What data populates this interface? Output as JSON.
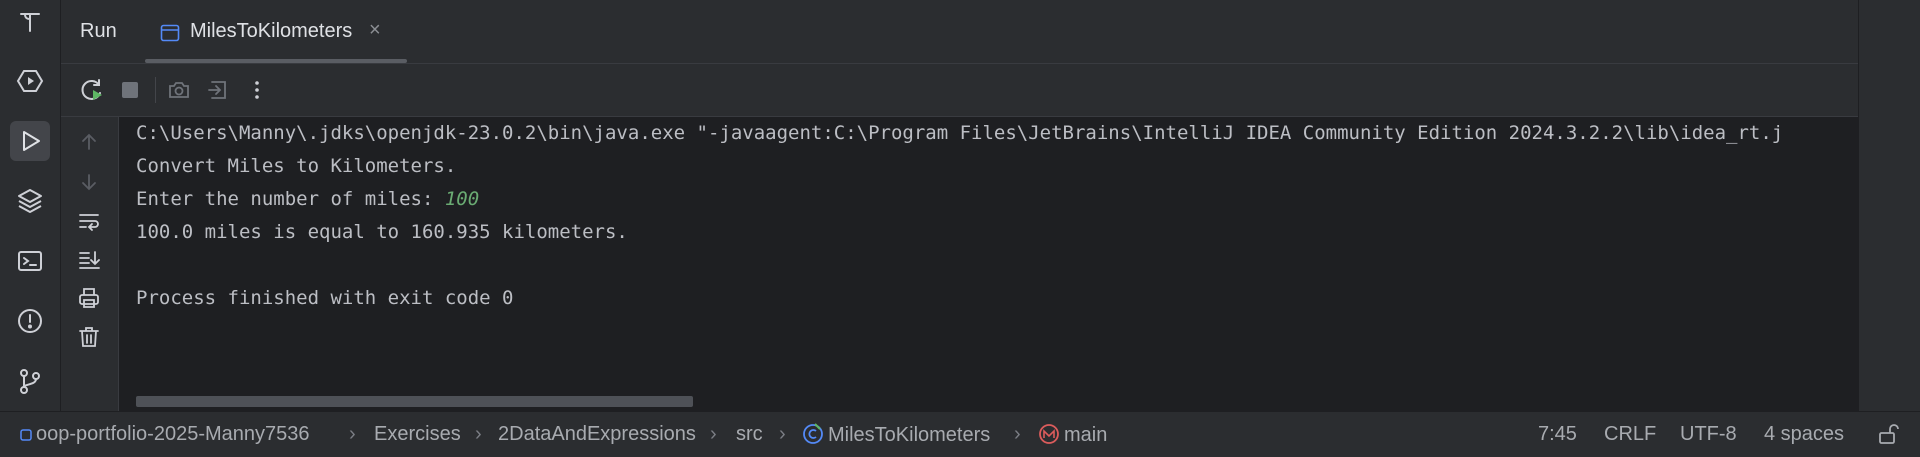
{
  "run_panel": {
    "title": "Run",
    "tab": {
      "label": "MilesToKilometers",
      "close": "×"
    }
  },
  "console": {
    "command_line": "C:\\Users\\Manny\\.jdks\\openjdk-23.0.2\\bin\\java.exe \"-javaagent:C:\\Program Files\\JetBrains\\IntelliJ IDEA Community Edition 2024.3.2.2\\lib\\idea_rt.j",
    "output_line1": "Convert Miles to Kilometers.",
    "prompt": "Enter the number of miles: ",
    "user_input": "100",
    "result": "100.0 miles is equal to 160.935 kilometers.",
    "exit_message": "Process finished with exit code 0"
  },
  "breadcrumbs": {
    "project": "oop-portfolio-2025-Manny7536",
    "folder1": "Exercises",
    "folder2": "2DataAndExpressions",
    "folder3": "src",
    "class": "MilesToKilometers",
    "method": "main"
  },
  "status": {
    "position": "7:45",
    "line_separator": "CRLF",
    "encoding": "UTF-8",
    "indent": "4 spaces"
  },
  "colors": {
    "background": "#1e1f22",
    "panel": "#2b2d30",
    "text": "#bcbec4",
    "user_input": "#6aab73",
    "run_accent": "#5fb865",
    "method_icon": "#db5c5c"
  }
}
